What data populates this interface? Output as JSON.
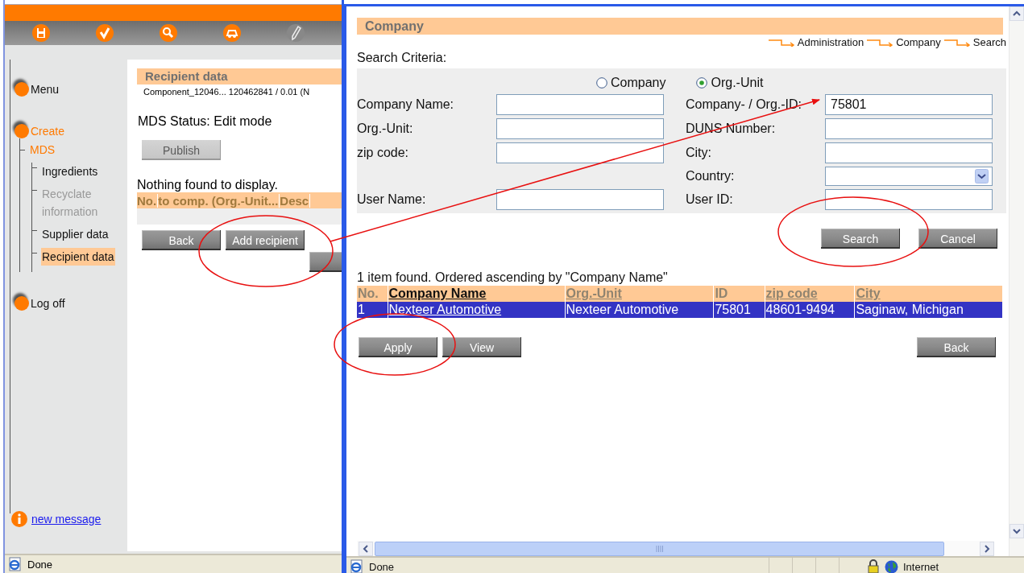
{
  "left_window": {
    "nav": [
      {
        "label": "Menu",
        "active": false
      },
      {
        "label": "Create",
        "active": true,
        "children": [
          {
            "label": "MDS",
            "active": true,
            "children": [
              {
                "label": "Ingredients",
                "selected": false,
                "disabled": false
              },
              {
                "label": "Recyclate information",
                "selected": false,
                "disabled": true
              },
              {
                "label": "Supplier data",
                "selected": false,
                "disabled": false
              },
              {
                "label": "Recipient data",
                "selected": true,
                "disabled": false
              }
            ]
          }
        ]
      },
      {
        "label": "Log off",
        "active": false
      }
    ],
    "message_link": "new message",
    "panel": {
      "title": "Recipient data",
      "subtitle": "Component_12046... 120462841 / 0.01 (N",
      "status": "MDS Status: Edit mode",
      "publish_button": {
        "label": "Publish",
        "disabled": true
      },
      "empty_text": "Nothing found to display.",
      "columns": [
        "No.",
        "to comp. (Org.-Unit...",
        "Desc"
      ],
      "buttons": [
        "Back",
        "Add recipient"
      ]
    },
    "status_bar": {
      "text": "Done"
    }
  },
  "right_window": {
    "title": "Company",
    "breadcrumb": [
      "Administration",
      "Company",
      "Search"
    ],
    "criteria_label": "Search Criteria:",
    "search_type": [
      {
        "label": "Company",
        "selected": false
      },
      {
        "label": "Org.-Unit",
        "selected": true
      }
    ],
    "form_rows": [
      {
        "left": {
          "label": "Company Name:"
        },
        "right": {
          "label": "Company- / Org.-ID:",
          "value": "75801"
        }
      },
      {
        "left": {
          "label": "Org.-Unit:"
        },
        "right": {
          "label": "DUNS Number:"
        }
      },
      {
        "left": {
          "label": "zip code:"
        },
        "right": {
          "label": "City:"
        }
      },
      {
        "right": {
          "label": "Country:",
          "kind": "select"
        }
      },
      {
        "left": {
          "label": "User Name:"
        },
        "right": {
          "label": "User ID:"
        }
      }
    ],
    "search_buttons": [
      "Search",
      "Cancel"
    ],
    "result_text": "1 item found. Ordered ascending by \"Company Name\"",
    "table": {
      "columns": [
        {
          "label": "No.",
          "sortable": false,
          "sorted": false
        },
        {
          "label": "Company Name",
          "sortable": true,
          "sorted": true
        },
        {
          "label": "Org.-Unit",
          "sortable": true,
          "sorted": false
        },
        {
          "label": "ID",
          "sortable": false,
          "sorted": false
        },
        {
          "label": "zip code",
          "sortable": true,
          "sorted": false
        },
        {
          "label": "City",
          "sortable": true,
          "sorted": false
        }
      ],
      "rows": [
        {
          "selected": true,
          "cells": [
            "1",
            "Nexteer Automotive",
            "Nexteer Automotive",
            "75801",
            "48601-9494",
            "Saginaw, Michigan"
          ]
        }
      ]
    },
    "action_buttons": [
      "Apply",
      "View"
    ],
    "back_button": "Back",
    "status_bar": {
      "text": "Done",
      "zone": "Internet"
    }
  }
}
